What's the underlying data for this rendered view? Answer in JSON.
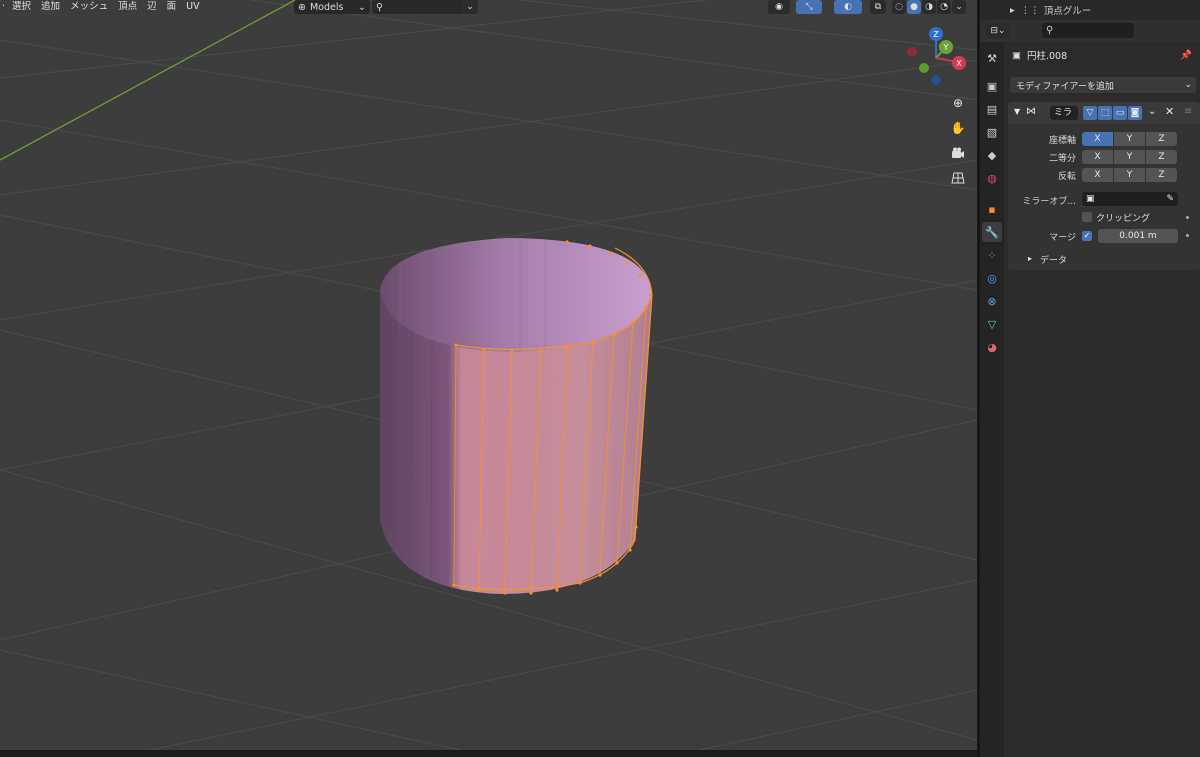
{
  "viewport": {
    "menu": [
      "選択",
      "追加",
      "メッシュ",
      "頂点",
      "辺",
      "面",
      "UV"
    ],
    "collection_dropdown": "Models",
    "search_placeholder": "",
    "colors": {
      "background": "#3d3d3d",
      "grid": "#4a4a4a",
      "x_axis_line": "#6f9c36",
      "mesh_side_dark": "#70506f",
      "mesh_side_light": "#c08ec0",
      "selected_edge": "#f5922d"
    },
    "gizmo": {
      "z": "Z",
      "y": "Y",
      "x": "X"
    }
  },
  "outliner": {
    "item_label": "頂点グルー"
  },
  "properties": {
    "search_placeholder": "",
    "object_name": "円柱.008",
    "add_modifier": "モディファイアーを追加",
    "modifier": {
      "name": "ミラ",
      "axis_label": "座標軸",
      "bisect_label": "二等分",
      "flip_label": "反転",
      "axes": [
        "X",
        "Y",
        "Z"
      ],
      "axis_enabled": [
        true,
        false,
        false
      ],
      "mirror_object_label": "ミラーオブ...",
      "clipping_label": "クリッピング",
      "clipping_checked": false,
      "merge_label": "マージ",
      "merge_checked": true,
      "merge_value": "0.001 m",
      "data_section": "データ"
    }
  }
}
